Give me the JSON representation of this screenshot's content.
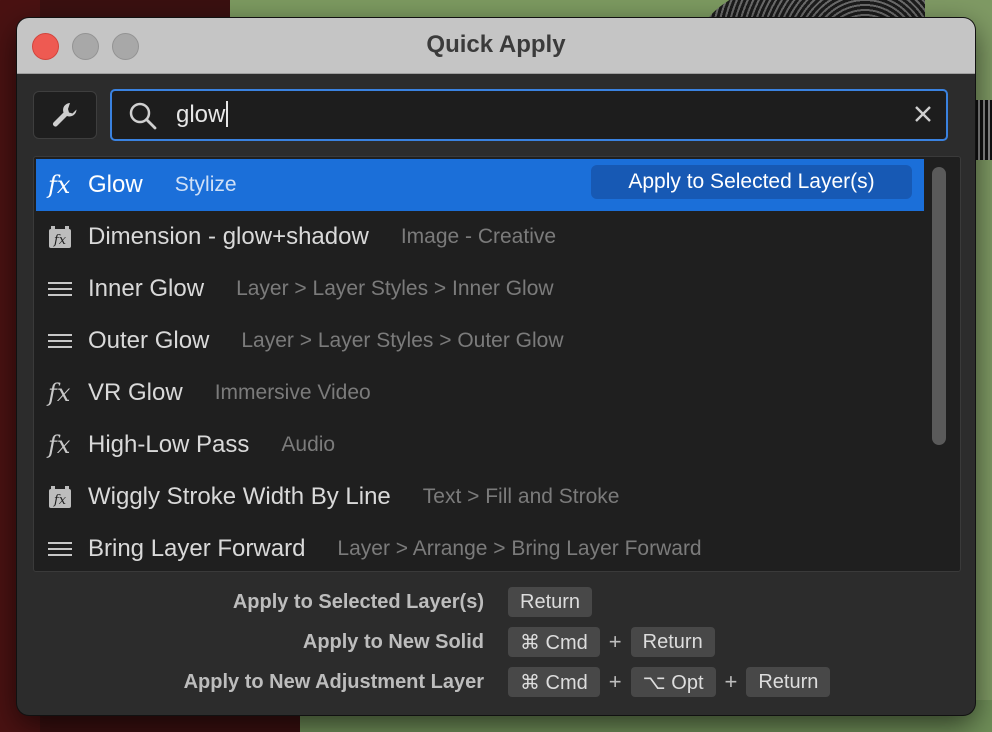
{
  "window": {
    "title": "Quick Apply"
  },
  "search": {
    "value": "glow"
  },
  "results": [
    {
      "icon": "fx-icon",
      "name": "Glow",
      "category": "Stylize",
      "selected": true
    },
    {
      "icon": "preset-fx-icon",
      "name": "Dimension - glow+shadow",
      "category": "Image - Creative"
    },
    {
      "icon": "menu-lines-icon",
      "name": "Inner Glow",
      "category": "Layer > Layer Styles > Inner Glow"
    },
    {
      "icon": "menu-lines-icon",
      "name": "Outer Glow",
      "category": "Layer > Layer Styles > Outer Glow"
    },
    {
      "icon": "fx-icon",
      "name": "VR Glow",
      "category": "Immersive Video"
    },
    {
      "icon": "fx-icon",
      "name": "High-Low Pass",
      "category": "Audio"
    },
    {
      "icon": "preset-fx-icon",
      "name": "Wiggly Stroke Width By Line",
      "category": "Text > Fill and Stroke"
    },
    {
      "icon": "menu-lines-icon",
      "name": "Bring Layer Forward",
      "category": "Layer > Arrange > Bring Layer Forward"
    }
  ],
  "fx_glyph": "fx",
  "apply_button": "Apply to Selected Layer(s)",
  "shortcuts": [
    {
      "label": "Apply to Selected Layer(s)",
      "keys": [
        "Return"
      ]
    },
    {
      "label": "Apply to New Solid",
      "keys": [
        "⌘ Cmd",
        "Return"
      ]
    },
    {
      "label": "Apply to New Adjustment Layer",
      "keys": [
        "⌘ Cmd",
        "⌥ Opt",
        "Return"
      ]
    }
  ],
  "plus_sign": "+",
  "colors": {
    "accent": "#1b6fd9",
    "focus_ring": "#3a82e0",
    "close": "#ee5a52"
  }
}
